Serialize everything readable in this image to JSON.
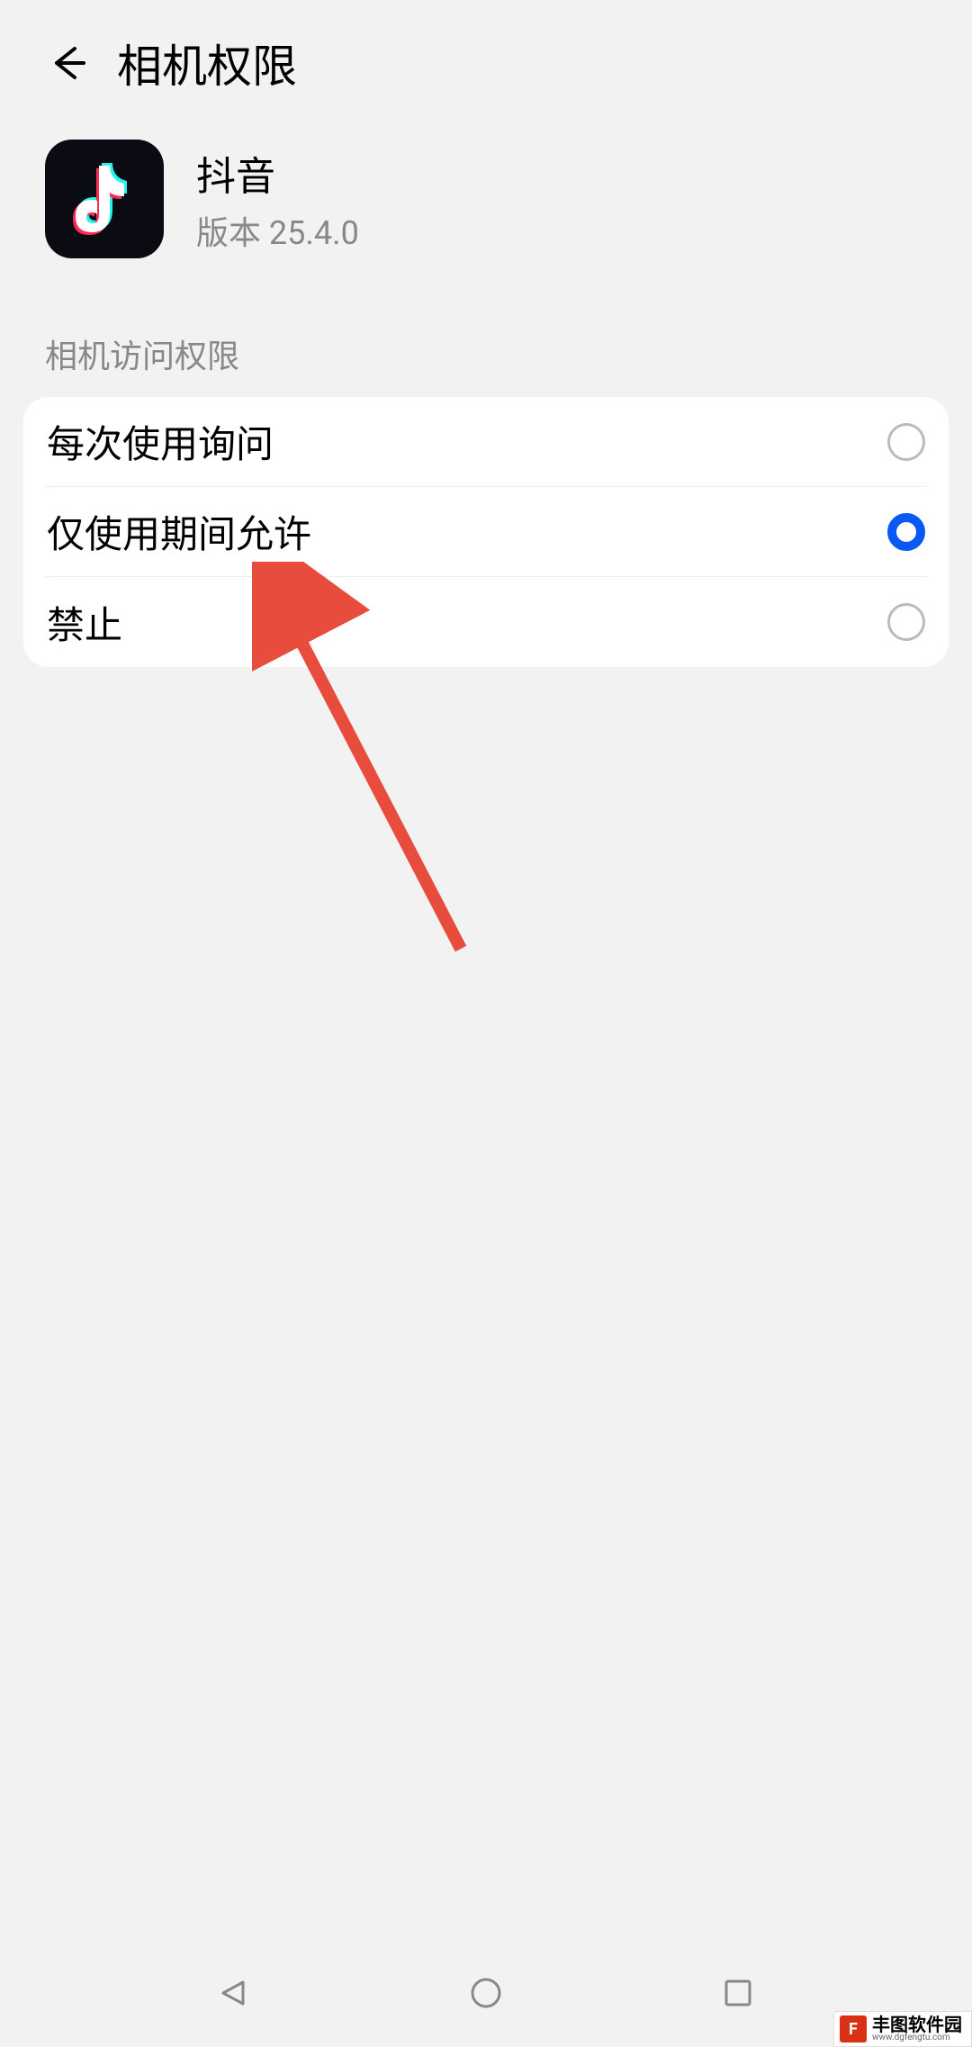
{
  "header": {
    "title": "相机权限"
  },
  "app": {
    "name": "抖音",
    "version_label": "版本 25.4.0"
  },
  "section": {
    "title": "相机访问权限"
  },
  "options": [
    {
      "label": "每次使用询问",
      "selected": false
    },
    {
      "label": "仅使用期间允许",
      "selected": true
    },
    {
      "label": "禁止",
      "selected": false
    }
  ],
  "watermark": {
    "name": "丰图软件园",
    "url": "www.dgfengtu.com"
  }
}
